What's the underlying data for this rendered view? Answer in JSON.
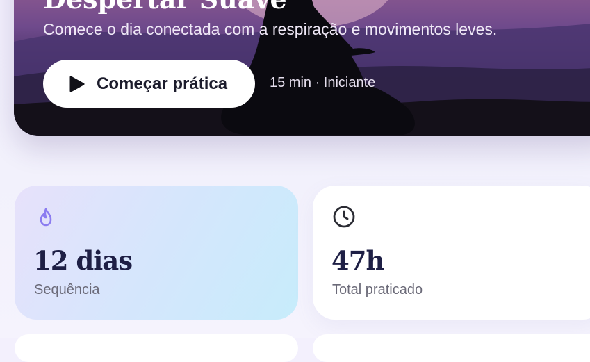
{
  "hero": {
    "title": "Despertar Suave",
    "subtitle": "Comece o dia conectada com a respiração e movimentos leves.",
    "start_button_label": "Começar prática",
    "meta": "15 min · Iniciante"
  },
  "stats": [
    {
      "icon": "flame-icon",
      "value": "12 dias",
      "label": "Sequência"
    },
    {
      "icon": "clock-icon",
      "value": "47h",
      "label": "Total praticado"
    }
  ],
  "colors": {
    "accent": "#8b7cf0",
    "text_dark": "#1e1f45",
    "text_muted": "#6b6a78"
  }
}
